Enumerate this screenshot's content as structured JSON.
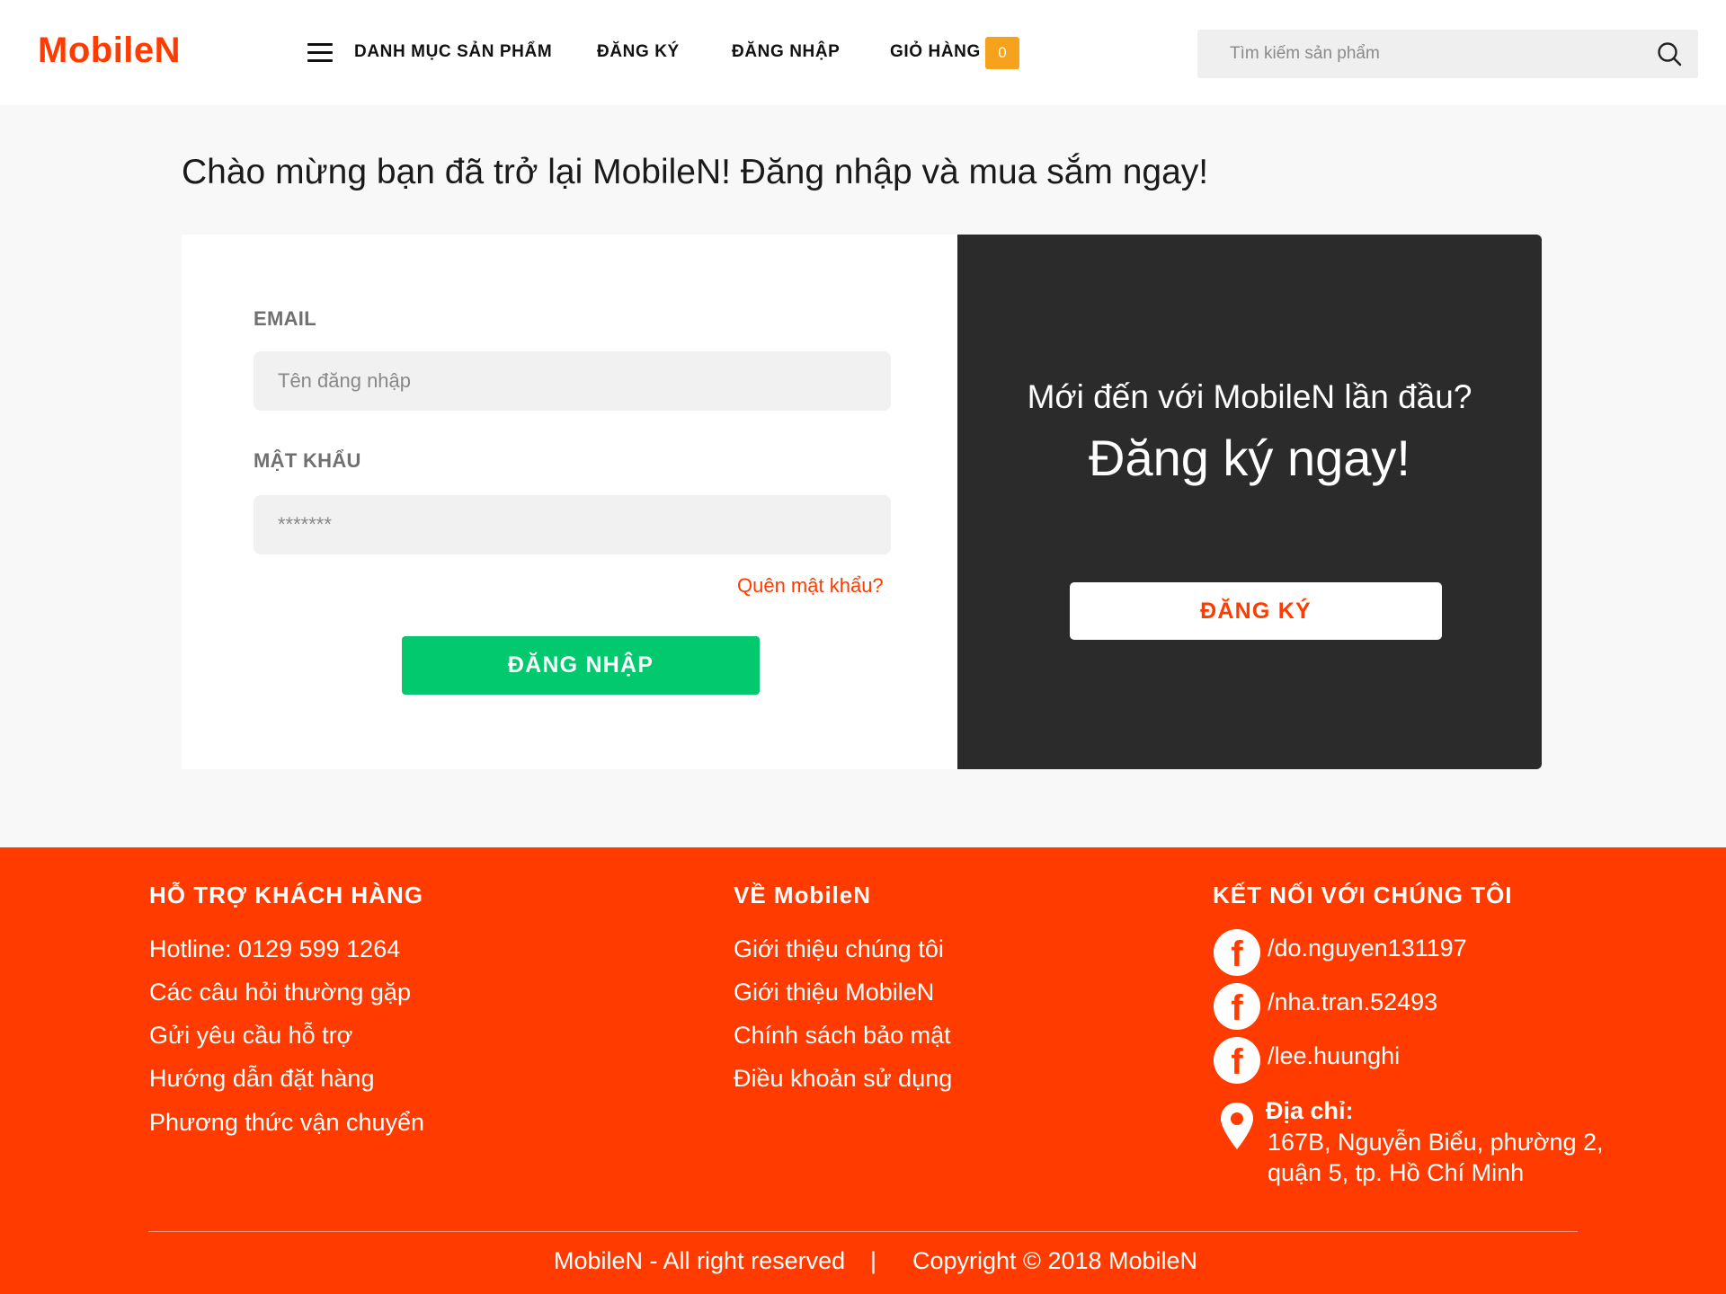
{
  "header": {
    "logo": "MobileN",
    "nav": {
      "categories": "DANH MỤC SẢN PHẨM",
      "register": "ĐĂNG KÝ",
      "login": "ĐĂNG NHẬP",
      "cart": "GIỎ HÀNG",
      "cart_count": "0"
    },
    "search": {
      "placeholder": "Tìm kiếm sản phẩm",
      "value": ""
    }
  },
  "welcome": "Chào mừng bạn đã trở lại MobileN! Đăng nhập và mua sắm ngay!",
  "login_form": {
    "email_label": "EMAIL",
    "email_placeholder": "Tên đăng nhập",
    "password_label": "MẬT KHẨU",
    "password_placeholder": "*******",
    "forgot": "Quên mật khẩu?",
    "submit": "ĐĂNG NHẬP"
  },
  "signup_panel": {
    "question": "Mới đến với MobileN lần đầu?",
    "cta": "Đăng ký ngay!",
    "button": "ĐĂNG KÝ"
  },
  "footer": {
    "support": {
      "title": "HỖ TRỢ KHÁCH HÀNG",
      "links": [
        "Hotline: 0129 599 1264",
        "Các câu hỏi thường gặp",
        "Gửi yêu cầu hỗ trợ",
        "Hướng dẫn đặt hàng",
        "Phương thức vận chuyển"
      ]
    },
    "about": {
      "title": "VỀ MobileN",
      "links": [
        "Giới thiệu chúng tôi",
        "Giới thiệu MobileN",
        "Chính sách bảo mật",
        "Điều khoản sử dụng"
      ]
    },
    "connect": {
      "title": "KẾT NỐI VỚI CHÚNG TÔI",
      "socials": [
        "/do.nguyen131197",
        "/nha.tran.52493",
        "/lee.huunghi"
      ],
      "address_label": "Địa chỉ:",
      "address_lines": [
        "167B, Nguyễn Biểu, phường 2,",
        "quận 5, tp. Hồ Chí Minh"
      ]
    },
    "rights": "MobileN - All right reserved",
    "separator": "|",
    "copyright": "Copyright © 2018 MobileN"
  },
  "colors": {
    "brand": "#ff3b00",
    "login_button": "#03c96e",
    "panel_dark": "#2b2b2b",
    "cart_badge": "#f6a21d"
  },
  "icons": [
    "hamburger-menu-icon",
    "search-icon",
    "facebook-icon",
    "location-pin-icon"
  ]
}
